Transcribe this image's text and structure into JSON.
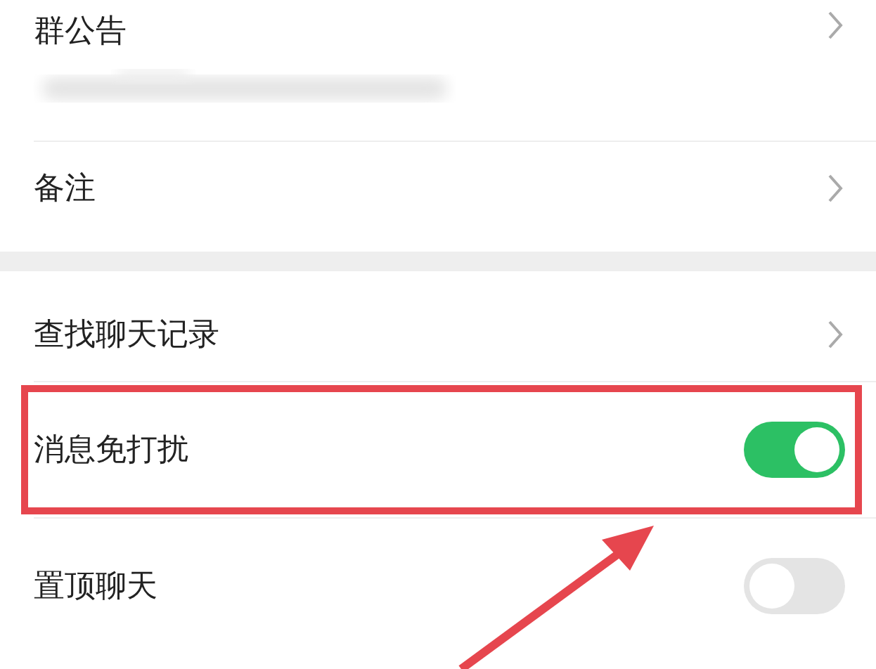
{
  "sections": [
    {
      "rows": [
        {
          "kind": "link",
          "label": "群公告",
          "blurred_note": true
        },
        {
          "kind": "link",
          "label": "备注"
        }
      ]
    },
    {
      "rows": [
        {
          "kind": "link",
          "label": "查找聊天记录"
        },
        {
          "kind": "toggle",
          "label": "消息免打扰",
          "on": true,
          "highlighted": true
        },
        {
          "kind": "toggle",
          "label": "置顶聊天",
          "on": false
        }
      ]
    }
  ]
}
